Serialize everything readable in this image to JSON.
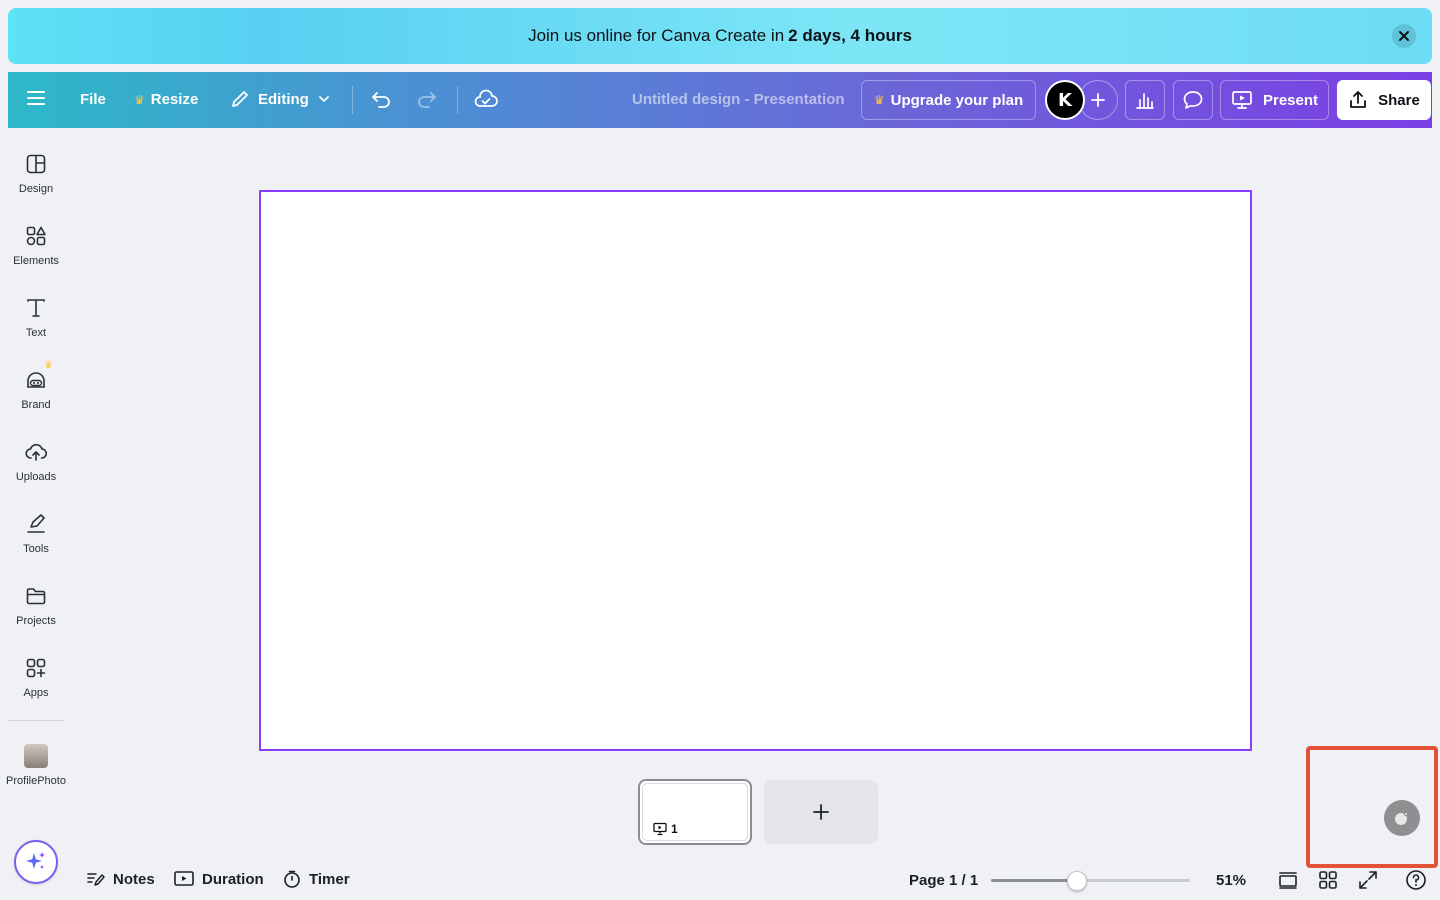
{
  "banner": {
    "text": "Join us online for Canva Create in",
    "highlight": "2 days, 4 hours"
  },
  "topbar": {
    "file": "File",
    "resize": "Resize",
    "editing": "Editing",
    "title": "Untitled design - Presentation",
    "upgrade": "Upgrade your plan",
    "avatar_letter": "K",
    "present": "Present",
    "share": "Share"
  },
  "sidebar": {
    "items": [
      {
        "label": "Design"
      },
      {
        "label": "Elements"
      },
      {
        "label": "Text"
      },
      {
        "label": "Brand"
      },
      {
        "label": "Uploads"
      },
      {
        "label": "Tools"
      },
      {
        "label": "Projects"
      },
      {
        "label": "Apps"
      },
      {
        "label": "ProfilePhoto"
      }
    ]
  },
  "pages": {
    "thumb_number": "1"
  },
  "bottombar": {
    "notes": "Notes",
    "duration": "Duration",
    "timer": "Timer",
    "page_indicator": "Page 1 / 1",
    "zoom_label": "51%",
    "zoom_fraction": 0.43
  },
  "colors": {
    "accent": "#8b3dff",
    "highlight_box": "#e2513a"
  }
}
